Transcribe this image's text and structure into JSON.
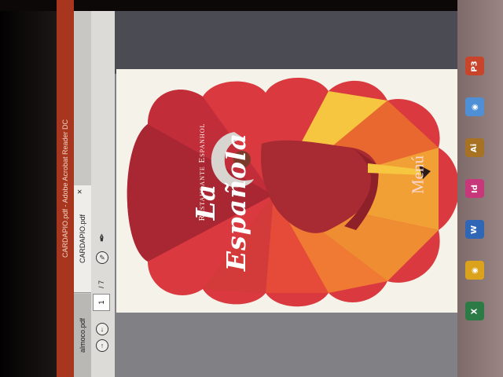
{
  "window": {
    "title": "CARDAPIO.pdf - Adobe Acrobat Reader DC"
  },
  "tabs": [
    {
      "label": "almoco.pdf",
      "active": false
    },
    {
      "label": "CARDAPIO.pdf",
      "active": true,
      "close": "×"
    }
  ],
  "toolbar": {
    "page_current": "1",
    "page_total": "/ 7",
    "icons": [
      "previous-page-icon",
      "next-page-icon",
      "comment-icon",
      "sign-pen-icon"
    ]
  },
  "document": {
    "restaurant_name": "La Española",
    "restaurant_subtitle": "Restaurante Espanhol",
    "menu_label": "Menú"
  },
  "taskbar": {
    "apps": [
      {
        "name": "powerpoint",
        "glyph": "P3",
        "color": "#c8452c"
      },
      {
        "name": "chrome",
        "glyph": "◉",
        "color": "#4f8fd6"
      },
      {
        "name": "illustrator",
        "glyph": "Ai",
        "color": "#a77224"
      },
      {
        "name": "indesign",
        "glyph": "Id",
        "color": "#c63879"
      },
      {
        "name": "word",
        "glyph": "W",
        "color": "#2f66b6"
      },
      {
        "name": "chrome-2",
        "glyph": "◉",
        "color": "#dba21c"
      },
      {
        "name": "excel",
        "glyph": "X",
        "color": "#2c7b47"
      }
    ]
  },
  "colors": {
    "fan_red": "#d9393f",
    "fan_dark": "#a92633",
    "fan_orange": "#f1a036",
    "fan_yellow": "#f6c640",
    "titlebar": "#a8351d"
  }
}
